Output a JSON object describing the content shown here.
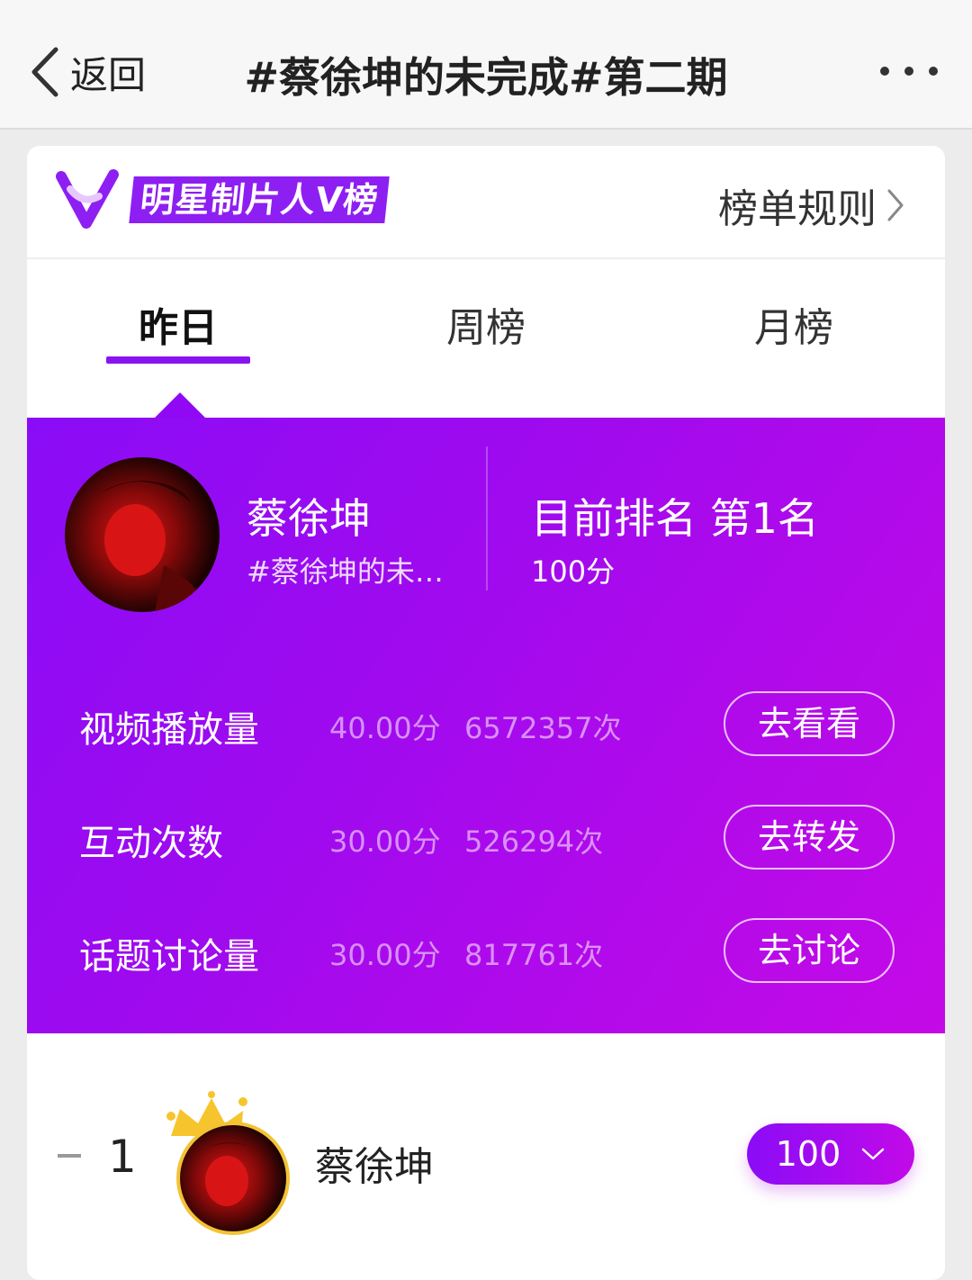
{
  "nav": {
    "back_label": "返回",
    "title": "#蔡徐坤的未完成#第二期",
    "more_icon": "more-dots-icon"
  },
  "header": {
    "logo_text": "明星制片人V榜",
    "rules_label": "榜单规则",
    "accent_color": "#8a14f0"
  },
  "tabs": [
    {
      "label": "昨日",
      "active": true
    },
    {
      "label": "周榜",
      "active": false
    },
    {
      "label": "月榜",
      "active": false
    }
  ],
  "star": {
    "name": "蔡徐坤",
    "subtitle": "#蔡徐坤的未…",
    "rank_text": "目前排名 第1名",
    "score_text": "100分"
  },
  "metrics": [
    {
      "label": "视频播放量",
      "points": "40.00分",
      "count": "6572357次",
      "action": "去看看"
    },
    {
      "label": "互动次数",
      "points": "30.00分",
      "count": "526294次",
      "action": "去转发"
    },
    {
      "label": "话题讨论量",
      "points": "30.00分",
      "count": "817761次",
      "action": "去讨论"
    }
  ],
  "list": [
    {
      "rank": "1",
      "name": "蔡徐坤",
      "score": "100"
    }
  ]
}
